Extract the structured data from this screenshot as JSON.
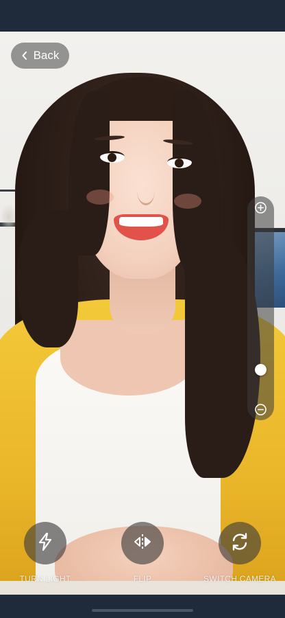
{
  "header": {
    "back_label": "Back"
  },
  "zoom": {
    "level": 0.12,
    "zoom_in_icon": "zoom-in-plus",
    "zoom_out_icon": "zoom-out-minus"
  },
  "controls": [
    {
      "id": "turn-light",
      "label": "TURN LIGHT",
      "icon": "flash-icon"
    },
    {
      "id": "flip",
      "label": "FLIP",
      "icon": "flip-horizontal-icon"
    },
    {
      "id": "switch-camera",
      "label": "SWITCH CAMERA",
      "icon": "camera-switch-icon"
    }
  ],
  "colors": {
    "system_bar": "#1f2a3b",
    "overlay": "#3c3c3c",
    "text": "#ffffff"
  }
}
